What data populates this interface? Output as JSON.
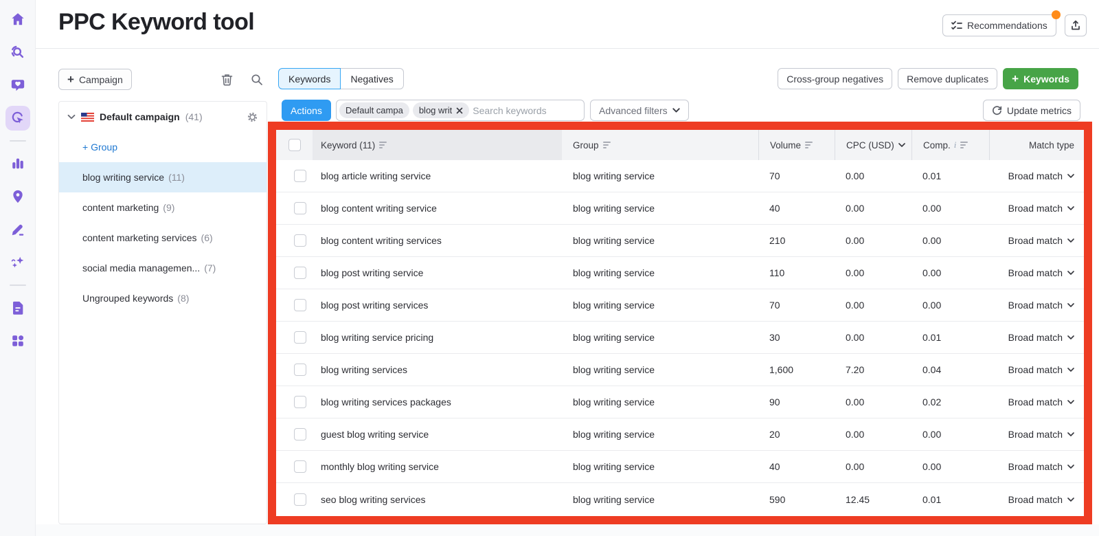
{
  "colors": {
    "accent-blue": "#2f9bf2",
    "accent-green": "#47a447",
    "annotation-red": "#ee3c23",
    "notification-orange": "#ff8c1a",
    "brand-purple": "#7d5fd8",
    "link-blue": "#1f78d1",
    "selected-row-blue": "#ddeefa",
    "tab-active-bg": "#e6f4fe",
    "tab-active-border": "#35a6f4"
  },
  "sidebar": {
    "items": [
      {
        "icon": "home-icon",
        "active": false
      },
      {
        "icon": "seo-toolkit-icon",
        "active": false
      },
      {
        "icon": "social-media-icon",
        "active": false
      },
      {
        "icon": "advertising-icon",
        "active": true
      },
      {
        "icon": "analytics-icon",
        "active": false
      },
      {
        "icon": "local-marketing-icon",
        "active": false
      },
      {
        "icon": "content-marketing-icon",
        "active": false
      },
      {
        "icon": "ai-tools-icon",
        "active": false
      },
      {
        "icon": "reports-icon",
        "active": false
      },
      {
        "icon": "more-apps-icon",
        "active": false
      }
    ]
  },
  "header": {
    "title": "PPC Keyword tool",
    "recommendations_label": "Recommendations",
    "has_notification_dot": true
  },
  "campaign_panel": {
    "campaign_button_label": "Campaign",
    "tree": {
      "campaign_name": "Default campaign",
      "campaign_count": "(41)",
      "add_group_label": "+ Group",
      "groups": [
        {
          "label": "blog writing service",
          "count": "(11)",
          "selected": true
        },
        {
          "label": "content marketing",
          "count": "(9)",
          "selected": false
        },
        {
          "label": "content marketing services",
          "count": "(6)",
          "selected": false
        },
        {
          "label": "social media managemen...",
          "count": "(7)",
          "selected": false
        },
        {
          "label": "Ungrouped keywords",
          "count": "(8)",
          "selected": false
        }
      ]
    }
  },
  "tabs": [
    {
      "label": "Keywords",
      "active": true
    },
    {
      "label": "Negatives",
      "active": false
    }
  ],
  "top_actions": {
    "cross_group_negatives": "Cross-group negatives",
    "remove_duplicates": "Remove duplicates",
    "add_keywords": "Keywords"
  },
  "toolbar": {
    "actions_label": "Actions",
    "filter_chips": [
      {
        "label": "Default campa",
        "closable": false
      },
      {
        "label": "blog writ",
        "closable": true
      }
    ],
    "search_placeholder": "Search keywords",
    "advanced_filters_label": "Advanced filters",
    "update_metrics_label": "Update metrics"
  },
  "table": {
    "columns": [
      {
        "key": "keyword",
        "label": "Keyword (11)",
        "sort": "bars",
        "highlight": true
      },
      {
        "key": "group",
        "label": "Group",
        "sort": "bars"
      },
      {
        "key": "volume",
        "label": "Volume",
        "sort": "bars"
      },
      {
        "key": "cpc",
        "label": "CPC (USD)",
        "sort": "chevron"
      },
      {
        "key": "comp",
        "label": "Comp.",
        "info": true,
        "sort": "bars"
      },
      {
        "key": "match",
        "label": "Match type"
      }
    ],
    "rows": [
      {
        "keyword": "blog article writing service",
        "group": "blog writing service",
        "volume": "70",
        "cpc": "0.00",
        "comp": "0.01",
        "match_type": "Broad match"
      },
      {
        "keyword": "blog content writing service",
        "group": "blog writing service",
        "volume": "40",
        "cpc": "0.00",
        "comp": "0.00",
        "match_type": "Broad match"
      },
      {
        "keyword": "blog content writing services",
        "group": "blog writing service",
        "volume": "210",
        "cpc": "0.00",
        "comp": "0.00",
        "match_type": "Broad match"
      },
      {
        "keyword": "blog post writing service",
        "group": "blog writing service",
        "volume": "110",
        "cpc": "0.00",
        "comp": "0.00",
        "match_type": "Broad match"
      },
      {
        "keyword": "blog post writing services",
        "group": "blog writing service",
        "volume": "70",
        "cpc": "0.00",
        "comp": "0.00",
        "match_type": "Broad match"
      },
      {
        "keyword": "blog writing service pricing",
        "group": "blog writing service",
        "volume": "30",
        "cpc": "0.00",
        "comp": "0.01",
        "match_type": "Broad match"
      },
      {
        "keyword": "blog writing services",
        "group": "blog writing service",
        "volume": "1,600",
        "cpc": "7.20",
        "comp": "0.04",
        "match_type": "Broad match"
      },
      {
        "keyword": "blog writing services packages",
        "group": "blog writing service",
        "volume": "90",
        "cpc": "0.00",
        "comp": "0.02",
        "match_type": "Broad match"
      },
      {
        "keyword": "guest blog writing service",
        "group": "blog writing service",
        "volume": "20",
        "cpc": "0.00",
        "comp": "0.00",
        "match_type": "Broad match"
      },
      {
        "keyword": "monthly blog writing service",
        "group": "blog writing service",
        "volume": "40",
        "cpc": "0.00",
        "comp": "0.00",
        "match_type": "Broad match"
      },
      {
        "keyword": "seo blog writing services",
        "group": "blog writing service",
        "volume": "590",
        "cpc": "12.45",
        "comp": "0.01",
        "match_type": "Broad match"
      }
    ]
  }
}
